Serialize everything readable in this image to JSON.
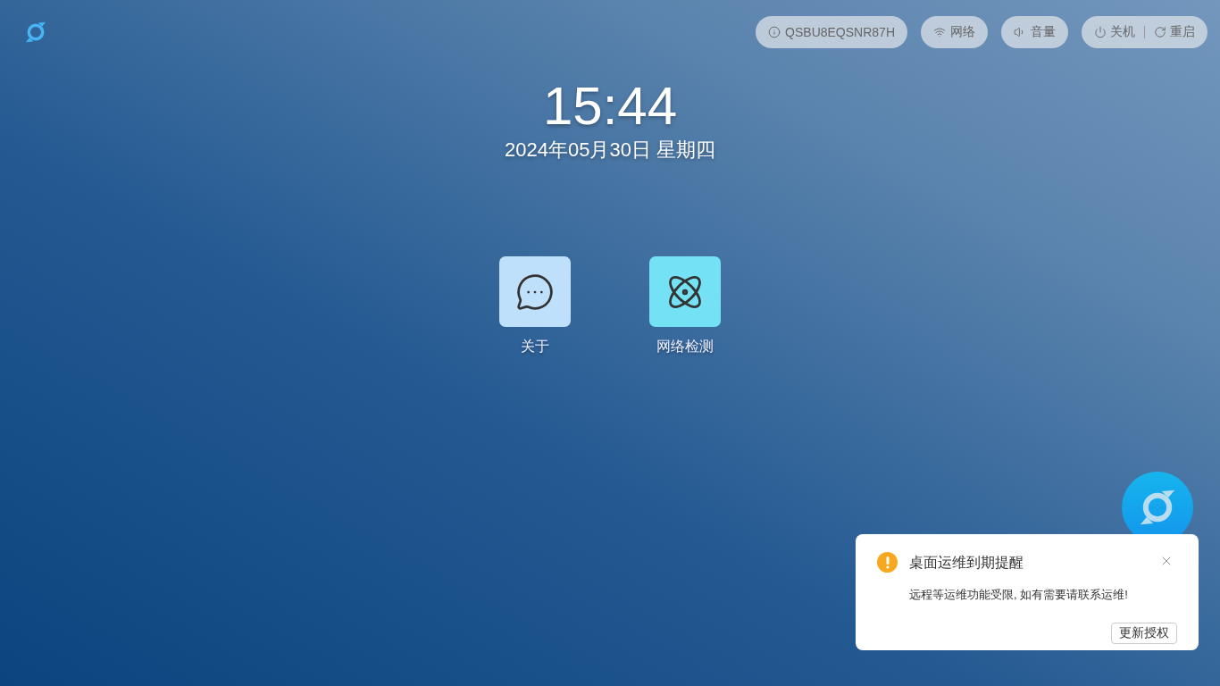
{
  "status_pills": [
    {
      "kind": "info",
      "label": "QSBU8EQSNR87H"
    },
    {
      "kind": "wifi",
      "label": "网络"
    },
    {
      "kind": "volume",
      "label": "音量"
    }
  ],
  "power": {
    "shutdown": "关机",
    "restart": "重启"
  },
  "clock": {
    "time": "15:44",
    "date": "2024年05月30日 星期四"
  },
  "apps": [
    {
      "kind": "chat",
      "label": "关于",
      "color": "#bfe0fa"
    },
    {
      "kind": "atom",
      "label": "网络检测",
      "color": "#74e1f5"
    }
  ],
  "notification": {
    "title": "桌面运维到期提醒",
    "message": "远程等运维功能受限, 如有需要请联系运维!",
    "button": "更新授权"
  }
}
